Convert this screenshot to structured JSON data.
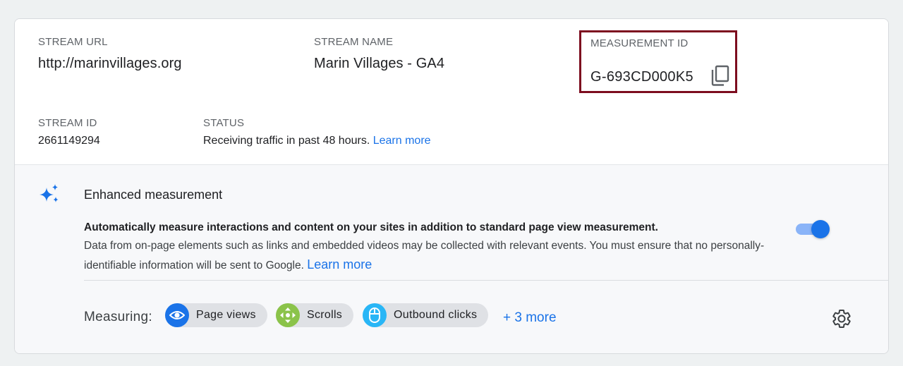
{
  "stream": {
    "url_label": "STREAM URL",
    "url_value": "http://marinvillages.org",
    "name_label": "STREAM NAME",
    "name_value": "Marin Villages - GA4",
    "measurement_label": "MEASUREMENT ID",
    "measurement_value": "G-693CD000K5",
    "id_label": "STREAM ID",
    "id_value": "2661149294",
    "status_label": "STATUS",
    "status_value": "Receiving traffic in past 48 hours.",
    "status_link": "Learn more"
  },
  "enhanced": {
    "title": "Enhanced measurement",
    "desc_bold": "Automatically measure interactions and content on your sites in addition to standard page view measurement.",
    "desc_text": "Data from on-page elements such as links and embedded videos may be collected with relevant events. You must ensure that no personally-identifiable information will be sent to Google.",
    "desc_link": "Learn more",
    "toggle_on": true
  },
  "measuring": {
    "label": "Measuring:",
    "chips": [
      {
        "label": "Page views",
        "icon": "eye-icon",
        "color": "#1a73e8"
      },
      {
        "label": "Scrolls",
        "icon": "move-arrows-icon",
        "color": "#8bc34a"
      },
      {
        "label": "Outbound clicks",
        "icon": "mouse-icon",
        "color": "#29b6f6"
      }
    ],
    "more": "+ 3 more"
  },
  "colors": {
    "accent": "#1a73e8",
    "highlight_border": "#7d0d1f"
  }
}
